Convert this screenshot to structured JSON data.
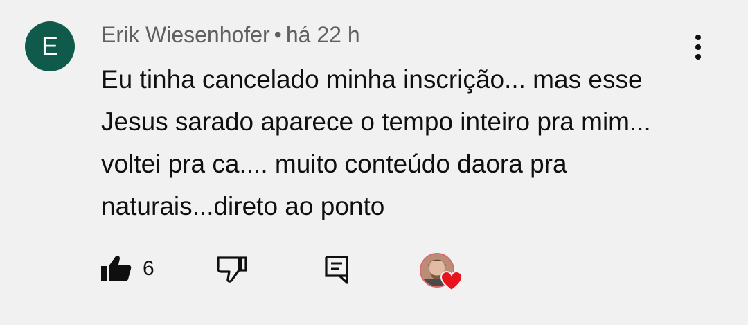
{
  "comment": {
    "avatar_letter": "E",
    "author": "Erik Wiesenhofer",
    "separator": "•",
    "time": "há 22 h",
    "text": "Eu tinha cancelado minha inscrição... mas esse Jesus sarado aparece o tempo inteiro pra mim... voltei pra ca.... muito conteúdo daora pra naturais...direto ao ponto",
    "like_count": "6"
  },
  "icons": {
    "more": "more-vert-icon",
    "like": "thumbs-up-icon",
    "dislike": "thumbs-down-icon",
    "reply": "comment-reply-icon",
    "heart": "heart-icon"
  },
  "colors": {
    "avatar_bg": "#0f5a4a",
    "heart": "#e8141d",
    "meta_text": "#606060"
  }
}
